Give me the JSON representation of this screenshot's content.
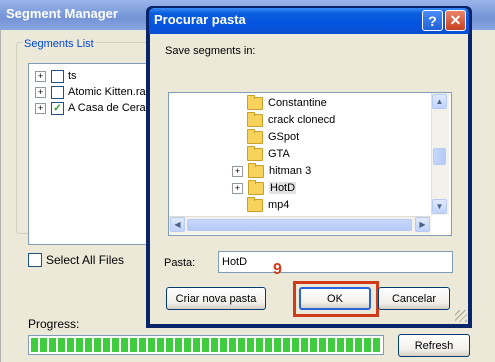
{
  "background_window": {
    "title": "Segment Manager",
    "segments_group_label": "Segments List",
    "tree_items": [
      {
        "label": "ts",
        "checked": false
      },
      {
        "label": "Atomic Kitten.ram",
        "checked": false
      },
      {
        "label": "A Casa de Cera",
        "checked": true
      }
    ],
    "select_all_label": "Select All Files",
    "progress_label": "Progress:",
    "progress_fraction": 1.0,
    "refresh_label": "Refresh"
  },
  "dialog": {
    "title": "Procurar pasta",
    "help_glyph": "?",
    "close_glyph": "✕",
    "save_label": "Save segments in:",
    "folders": [
      {
        "label": "Constantine",
        "expandable": false,
        "selected": false
      },
      {
        "label": "crack clonecd",
        "expandable": false,
        "selected": false
      },
      {
        "label": "GSpot",
        "expandable": false,
        "selected": false
      },
      {
        "label": "GTA",
        "expandable": false,
        "selected": false
      },
      {
        "label": "hitman 3",
        "expandable": true,
        "selected": false
      },
      {
        "label": "HotD",
        "expandable": true,
        "selected": true
      },
      {
        "label": "mp4",
        "expandable": false,
        "selected": false
      }
    ],
    "folder_label": "Pasta:",
    "folder_value": "HotD",
    "new_folder_label": "Criar nova pasta",
    "ok_label": "OK",
    "cancel_label": "Cancelar"
  },
  "annotation": {
    "step_number": "9",
    "color": "#d03b1a"
  },
  "colors": {
    "dialog_title_blue": "#0a5fdc",
    "window_bg": "#ECE9D8",
    "progress_green": "#3fcc3f"
  }
}
